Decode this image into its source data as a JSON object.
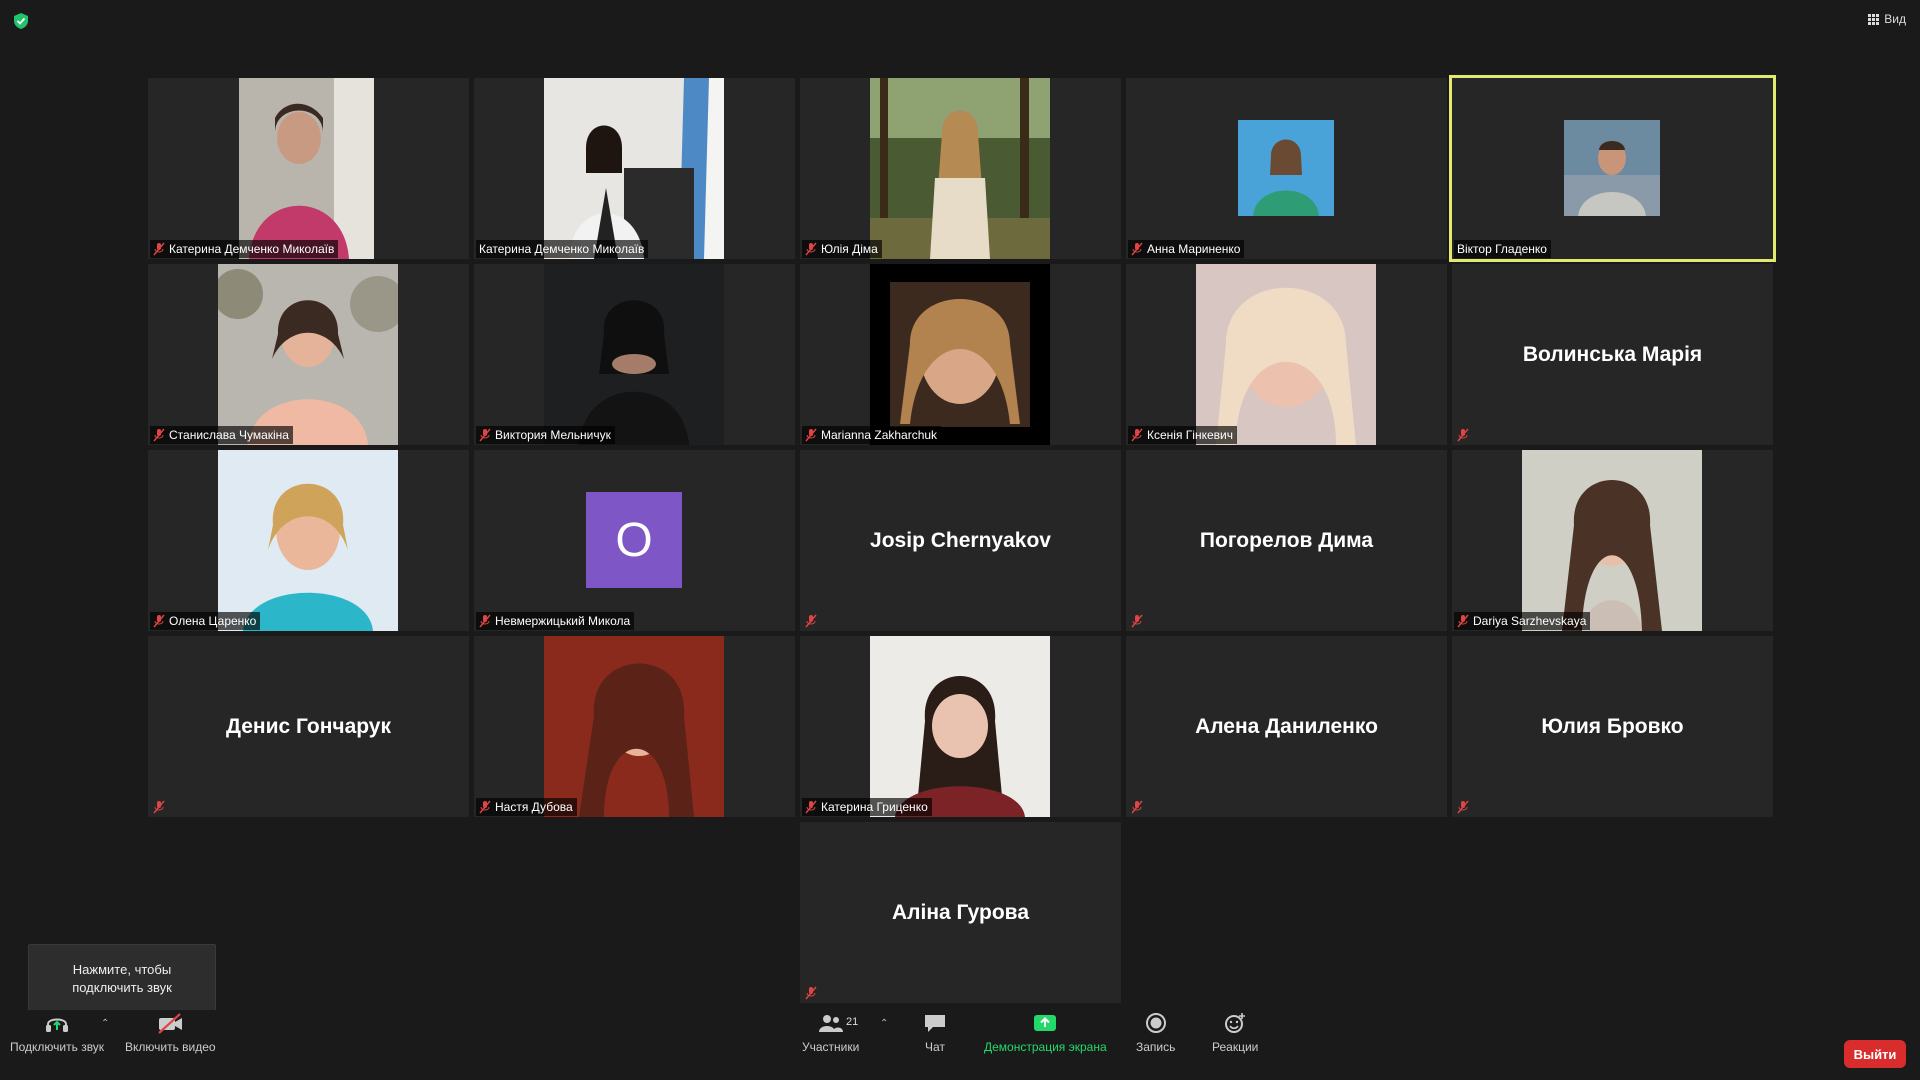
{
  "topbar": {
    "view_label": "Вид"
  },
  "participants": [
    {
      "name": "Катерина Демченко Миколаїв",
      "muted": true,
      "video": true,
      "photo": "woman-pink-sweater"
    },
    {
      "name": "Катерина Демченко Миколаїв",
      "muted": false,
      "video": true,
      "photo": "woman-office-flag"
    },
    {
      "name": "Юлія Діма",
      "muted": true,
      "video": true,
      "photo": "woman-forest"
    },
    {
      "name": "Анна Мариненко",
      "muted": true,
      "video": true,
      "photo": "woman-green-shirt"
    },
    {
      "name": "Віктор Гладенко",
      "muted": false,
      "video": true,
      "photo": "man-smiling",
      "active_speaker": true
    },
    {
      "name": "Станислава Чумакіна",
      "muted": true,
      "video": true,
      "photo": "woman-peach-sweater"
    },
    {
      "name": "Виктория Мельничук",
      "muted": true,
      "video": true,
      "photo": "woman-dark-room"
    },
    {
      "name": "Marianna Zakharchuk",
      "muted": true,
      "video": true,
      "photo": "woman-portrait-dark"
    },
    {
      "name": "Ксенія Гінкевич",
      "muted": true,
      "video": true,
      "photo": "woman-blonde-closeup"
    },
    {
      "name": "Волинська Марія",
      "muted": true,
      "video": false
    },
    {
      "name": "Олена Царенко",
      "muted": true,
      "video": true,
      "photo": "woman-blue-background"
    },
    {
      "name": "Невмержицький Микола",
      "muted": true,
      "video": false,
      "avatar_letter": "О",
      "avatar_color": "#7f56c5"
    },
    {
      "name": "Josip Chernyakov",
      "muted": true,
      "video": false
    },
    {
      "name": "Погорелов Дима",
      "muted": true,
      "video": false
    },
    {
      "name": "Dariya Sarzhevskaya",
      "muted": true,
      "video": true,
      "photo": "woman-long-hair"
    },
    {
      "name": "Денис Гончарук",
      "muted": true,
      "video": false
    },
    {
      "name": "Настя Дубова",
      "muted": true,
      "video": true,
      "photo": "woman-red-background"
    },
    {
      "name": "Катерина Гриценко",
      "muted": true,
      "video": true,
      "photo": "woman-white-wall"
    },
    {
      "name": "Алена Даниленко",
      "muted": true,
      "video": false
    },
    {
      "name": "Юлия Бровко",
      "muted": true,
      "video": false
    },
    {
      "name": "Аліна Гурова",
      "muted": true,
      "video": false
    }
  ],
  "tooltip": {
    "text_line1": "Нажмите, чтобы",
    "text_line2": "подключить звук"
  },
  "toolbar": {
    "audio_label": "Подключить звук",
    "video_label": "Включить видео",
    "participants_label": "Участники",
    "participants_count": "21",
    "chat_label": "Чат",
    "share_label": "Демонстрация экрана",
    "record_label": "Запись",
    "reactions_label": "Реакции",
    "leave_label": "Выйти"
  },
  "colors": {
    "active_speaker": "#e3e96f",
    "share_green": "#23d96b",
    "leave_red": "#d92d2d",
    "muted_red": "#e04444"
  }
}
